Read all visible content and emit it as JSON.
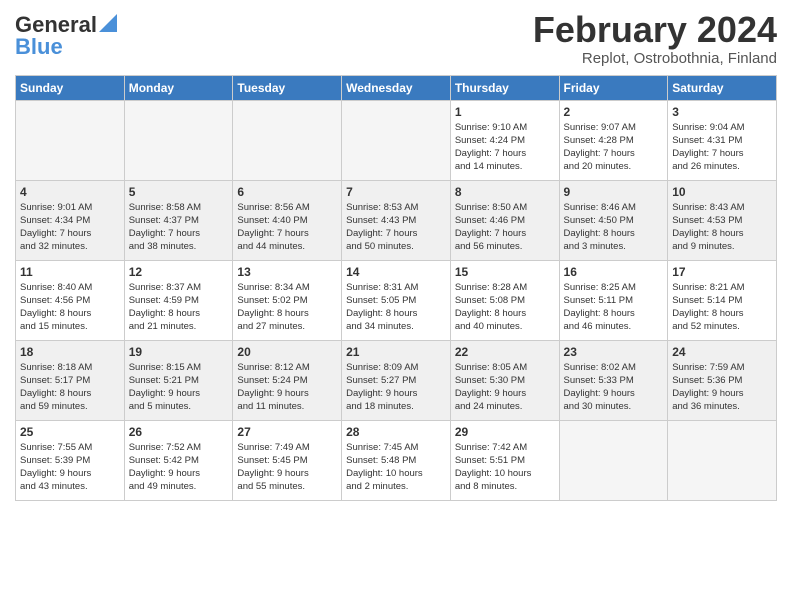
{
  "header": {
    "logo_general": "General",
    "logo_blue": "Blue",
    "month_title": "February 2024",
    "location": "Replot, Ostrobothnia, Finland"
  },
  "days_of_week": [
    "Sunday",
    "Monday",
    "Tuesday",
    "Wednesday",
    "Thursday",
    "Friday",
    "Saturday"
  ],
  "weeks": [
    [
      {
        "day": "",
        "info": ""
      },
      {
        "day": "",
        "info": ""
      },
      {
        "day": "",
        "info": ""
      },
      {
        "day": "",
        "info": ""
      },
      {
        "day": "1",
        "info": "Sunrise: 9:10 AM\nSunset: 4:24 PM\nDaylight: 7 hours\nand 14 minutes."
      },
      {
        "day": "2",
        "info": "Sunrise: 9:07 AM\nSunset: 4:28 PM\nDaylight: 7 hours\nand 20 minutes."
      },
      {
        "day": "3",
        "info": "Sunrise: 9:04 AM\nSunset: 4:31 PM\nDaylight: 7 hours\nand 26 minutes."
      }
    ],
    [
      {
        "day": "4",
        "info": "Sunrise: 9:01 AM\nSunset: 4:34 PM\nDaylight: 7 hours\nand 32 minutes."
      },
      {
        "day": "5",
        "info": "Sunrise: 8:58 AM\nSunset: 4:37 PM\nDaylight: 7 hours\nand 38 minutes."
      },
      {
        "day": "6",
        "info": "Sunrise: 8:56 AM\nSunset: 4:40 PM\nDaylight: 7 hours\nand 44 minutes."
      },
      {
        "day": "7",
        "info": "Sunrise: 8:53 AM\nSunset: 4:43 PM\nDaylight: 7 hours\nand 50 minutes."
      },
      {
        "day": "8",
        "info": "Sunrise: 8:50 AM\nSunset: 4:46 PM\nDaylight: 7 hours\nand 56 minutes."
      },
      {
        "day": "9",
        "info": "Sunrise: 8:46 AM\nSunset: 4:50 PM\nDaylight: 8 hours\nand 3 minutes."
      },
      {
        "day": "10",
        "info": "Sunrise: 8:43 AM\nSunset: 4:53 PM\nDaylight: 8 hours\nand 9 minutes."
      }
    ],
    [
      {
        "day": "11",
        "info": "Sunrise: 8:40 AM\nSunset: 4:56 PM\nDaylight: 8 hours\nand 15 minutes."
      },
      {
        "day": "12",
        "info": "Sunrise: 8:37 AM\nSunset: 4:59 PM\nDaylight: 8 hours\nand 21 minutes."
      },
      {
        "day": "13",
        "info": "Sunrise: 8:34 AM\nSunset: 5:02 PM\nDaylight: 8 hours\nand 27 minutes."
      },
      {
        "day": "14",
        "info": "Sunrise: 8:31 AM\nSunset: 5:05 PM\nDaylight: 8 hours\nand 34 minutes."
      },
      {
        "day": "15",
        "info": "Sunrise: 8:28 AM\nSunset: 5:08 PM\nDaylight: 8 hours\nand 40 minutes."
      },
      {
        "day": "16",
        "info": "Sunrise: 8:25 AM\nSunset: 5:11 PM\nDaylight: 8 hours\nand 46 minutes."
      },
      {
        "day": "17",
        "info": "Sunrise: 8:21 AM\nSunset: 5:14 PM\nDaylight: 8 hours\nand 52 minutes."
      }
    ],
    [
      {
        "day": "18",
        "info": "Sunrise: 8:18 AM\nSunset: 5:17 PM\nDaylight: 8 hours\nand 59 minutes."
      },
      {
        "day": "19",
        "info": "Sunrise: 8:15 AM\nSunset: 5:21 PM\nDaylight: 9 hours\nand 5 minutes."
      },
      {
        "day": "20",
        "info": "Sunrise: 8:12 AM\nSunset: 5:24 PM\nDaylight: 9 hours\nand 11 minutes."
      },
      {
        "day": "21",
        "info": "Sunrise: 8:09 AM\nSunset: 5:27 PM\nDaylight: 9 hours\nand 18 minutes."
      },
      {
        "day": "22",
        "info": "Sunrise: 8:05 AM\nSunset: 5:30 PM\nDaylight: 9 hours\nand 24 minutes."
      },
      {
        "day": "23",
        "info": "Sunrise: 8:02 AM\nSunset: 5:33 PM\nDaylight: 9 hours\nand 30 minutes."
      },
      {
        "day": "24",
        "info": "Sunrise: 7:59 AM\nSunset: 5:36 PM\nDaylight: 9 hours\nand 36 minutes."
      }
    ],
    [
      {
        "day": "25",
        "info": "Sunrise: 7:55 AM\nSunset: 5:39 PM\nDaylight: 9 hours\nand 43 minutes."
      },
      {
        "day": "26",
        "info": "Sunrise: 7:52 AM\nSunset: 5:42 PM\nDaylight: 9 hours\nand 49 minutes."
      },
      {
        "day": "27",
        "info": "Sunrise: 7:49 AM\nSunset: 5:45 PM\nDaylight: 9 hours\nand 55 minutes."
      },
      {
        "day": "28",
        "info": "Sunrise: 7:45 AM\nSunset: 5:48 PM\nDaylight: 10 hours\nand 2 minutes."
      },
      {
        "day": "29",
        "info": "Sunrise: 7:42 AM\nSunset: 5:51 PM\nDaylight: 10 hours\nand 8 minutes."
      },
      {
        "day": "",
        "info": ""
      },
      {
        "day": "",
        "info": ""
      }
    ]
  ]
}
